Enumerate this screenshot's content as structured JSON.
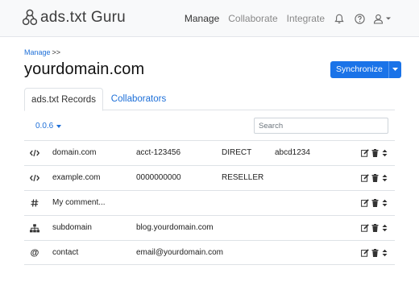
{
  "brand": {
    "name": "ads.txt Guru"
  },
  "nav": {
    "links": [
      "Manage",
      "Collaborate",
      "Integrate"
    ],
    "active": "Manage",
    "icons": [
      "bell-icon",
      "help-circle-icon",
      "user-icon"
    ]
  },
  "breadcrumb": {
    "link": "Manage",
    "separator": ">>"
  },
  "page": {
    "title": "yourdomain.com"
  },
  "actions": {
    "synchronize_label": "Synchronize"
  },
  "tabs": [
    {
      "label": "ads.txt Records",
      "active": true
    },
    {
      "label": "Collaborators",
      "active": false
    }
  ],
  "toolbar": {
    "version": "0.0.6",
    "search_placeholder": "Search"
  },
  "records": [
    {
      "icon": "code-icon",
      "cells": [
        "domain.com",
        "acct-123456",
        "DIRECT",
        "abcd1234"
      ]
    },
    {
      "icon": "code-icon",
      "cells": [
        "example.com",
        "0000000000",
        "RESELLER",
        ""
      ]
    },
    {
      "icon": "hash-icon",
      "cells": [
        "My comment...",
        "",
        "",
        ""
      ]
    },
    {
      "icon": "sitemap-icon",
      "cells": [
        "subdomain",
        "blog.yourdomain.com",
        "",
        ""
      ]
    },
    {
      "icon": "at-icon",
      "cells": [
        "contact",
        "email@yourdomain.com",
        "",
        ""
      ]
    }
  ],
  "colors": {
    "primary": "#1a73e8",
    "link": "#1d6fd8",
    "navbar": "#f8f9fa",
    "border": "#dee2e6"
  }
}
